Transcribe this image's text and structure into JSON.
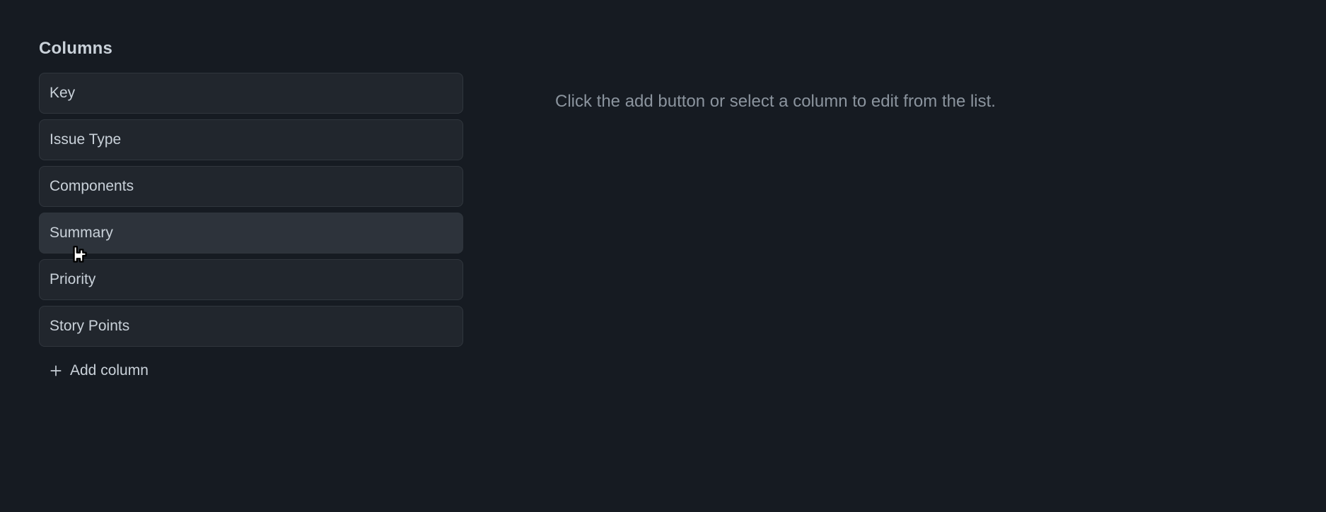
{
  "columns": {
    "heading": "Columns",
    "items": [
      {
        "label": "Key"
      },
      {
        "label": "Issue Type"
      },
      {
        "label": "Components"
      },
      {
        "label": "Summary"
      },
      {
        "label": "Priority"
      },
      {
        "label": "Story Points"
      }
    ],
    "add_button_label": "Add column"
  },
  "detail": {
    "hint": "Click the add button or select a column to edit from the list."
  }
}
